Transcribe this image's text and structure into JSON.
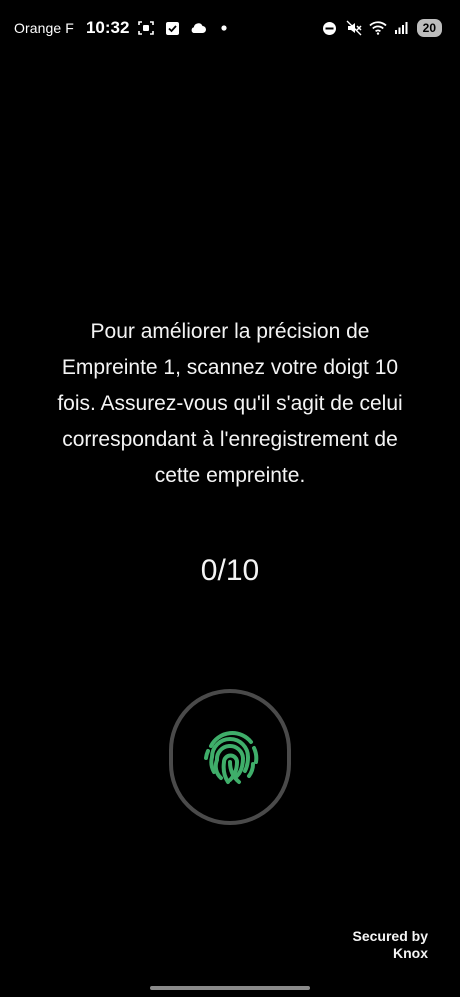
{
  "status_bar": {
    "carrier": "Orange F",
    "time": "10:32",
    "battery": "20",
    "icons_left": [
      "screenshot-icon",
      "checkbox-icon",
      "cloud-icon",
      "dot-icon"
    ],
    "icons_right": [
      "do-not-disturb-icon",
      "mute-icon",
      "wifi-icon",
      "signal-icon"
    ]
  },
  "main": {
    "instruction": "Pour améliorer la précision de Empreinte 1, scannez votre doigt 10 fois. Assurez-vous qu'il s'agit de celui correspondant à l'enregistrement de cette empreinte.",
    "instruction_lines": [
      "Pour améliorer la précision de",
      "Empreinte 1, scannez votre doigt 10",
      "fois. Assurez-vous qu'il s'agit de celui",
      "correspondant à l'enregistrement de",
      "cette empreinte."
    ],
    "progress": "0/10"
  },
  "footer": {
    "secured_line1": "Secured by",
    "secured_line2": "Knox"
  },
  "colors": {
    "background": "#000000",
    "fingerprint": "#3fae6a",
    "sensor_ring": "#4a4a4a"
  }
}
